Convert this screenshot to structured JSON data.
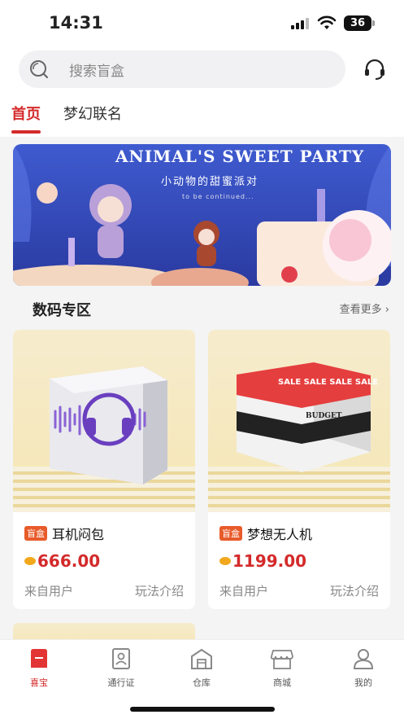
{
  "status_bar": {
    "time": "14:31",
    "battery": "36"
  },
  "search": {
    "placeholder": "搜索盲盒"
  },
  "tabs": [
    {
      "label": "首页",
      "active": true
    },
    {
      "label": "梦幻联名",
      "active": false
    }
  ],
  "banner": {
    "title": "ANIMAL'S SWEET PARTY",
    "subtitle": "小动物的甜蜜派对",
    "tagline": "to be continued..."
  },
  "section": {
    "title": "数码专区",
    "more_label": "查看更多"
  },
  "products": [
    {
      "badge": "盲盒",
      "name": "耳机闷包",
      "price": "666.00",
      "source": "来自用户",
      "guide": "玩法介绍"
    },
    {
      "badge": "盲盒",
      "name": "梦想无人机",
      "price": "1199.00",
      "source": "来自用户",
      "guide": "玩法介绍",
      "box_text": "SALE SALE SALE SALE",
      "box_brand": "BUDGET"
    }
  ],
  "bottom_nav": [
    {
      "label": "喜宝",
      "icon": "home-icon",
      "active": true
    },
    {
      "label": "通行证",
      "icon": "pass-icon",
      "active": false
    },
    {
      "label": "仓库",
      "icon": "warehouse-icon",
      "active": false
    },
    {
      "label": "商城",
      "icon": "store-icon",
      "active": false
    },
    {
      "label": "我的",
      "icon": "profile-icon",
      "active": false
    }
  ],
  "colors": {
    "accent": "#d42a2a",
    "coin": "#f2a81d",
    "badge": "#e85b2a"
  }
}
